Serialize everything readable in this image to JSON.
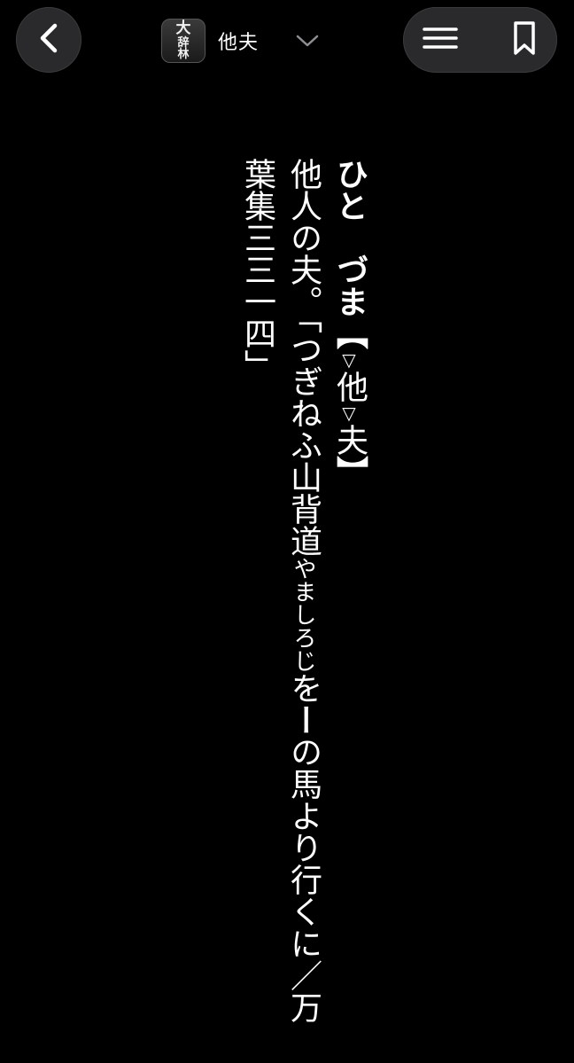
{
  "nav": {
    "back_icon": "chevron-left-icon",
    "app_icon_line1": "大",
    "app_icon_line2": "辞",
    "app_icon_line3": "林",
    "title": "他夫",
    "dropdown_icon": "chevron-down-icon",
    "menu_icon": "hamburger-menu-icon",
    "bookmark_icon": "bookmark-icon"
  },
  "entry": {
    "reading": "ひと　づま",
    "bracket_open": "【",
    "mark1": "▽",
    "kanji1": "他",
    "mark2": "▽",
    "kanji2": "夫",
    "bracket_close": "】",
    "definition": "他人の夫。",
    "quote_part1": "「つぎねふ山背道",
    "quote_ruby": "やましろじ",
    "quote_part2": "を",
    "quote_dash": "ー",
    "quote_part3": "の馬より行くに／万",
    "quote_part4": "葉集三三一四」"
  },
  "colors": {
    "background": "#000000",
    "text": "#ffffff",
    "button_bg": "#2a2a2c"
  }
}
